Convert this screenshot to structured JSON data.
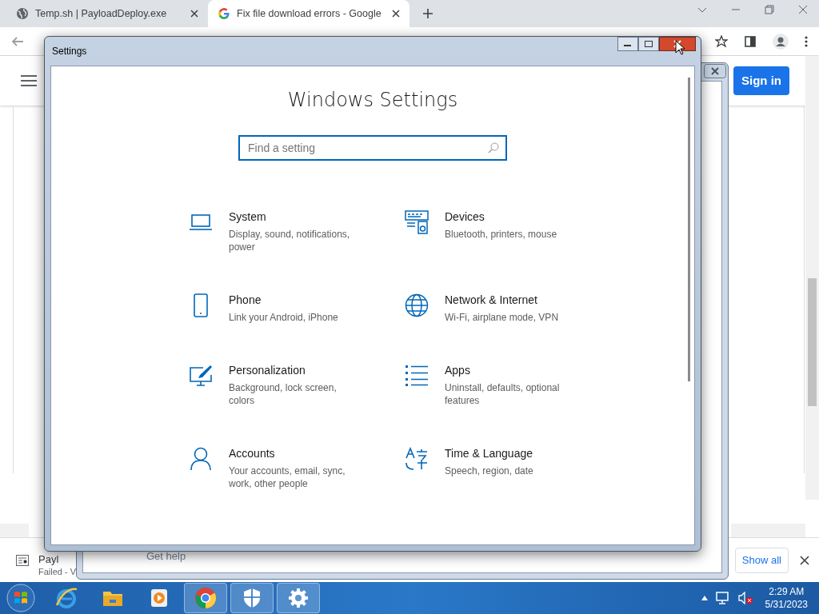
{
  "browser": {
    "tabs": [
      {
        "title": "Temp.sh | PayloadDeploy.exe",
        "kind": "globe",
        "selected": false
      },
      {
        "title": "Fix file download errors - Google",
        "kind": "google",
        "selected": true
      }
    ],
    "sign_in": "Sign in"
  },
  "download_bar": {
    "file_name": "Payl",
    "status": "Failed - V",
    "help": "Get help",
    "show_all": "Show all"
  },
  "settings_window": {
    "title": "Settings",
    "heading": "Windows Settings",
    "search": {
      "placeholder": "Find a setting"
    },
    "items": [
      {
        "kind": "system",
        "title": "System",
        "description": "Display, sound, notifications, power"
      },
      {
        "kind": "devices",
        "title": "Devices",
        "description": "Bluetooth, printers, mouse"
      },
      {
        "kind": "phone",
        "title": "Phone",
        "description": "Link your Android, iPhone"
      },
      {
        "kind": "network",
        "title": "Network & Internet",
        "description": "Wi-Fi, airplane mode, VPN"
      },
      {
        "kind": "personalization",
        "title": "Personalization",
        "description": "Background, lock screen, colors"
      },
      {
        "kind": "apps",
        "title": "Apps",
        "description": "Uninstall, defaults, optional features"
      },
      {
        "kind": "accounts",
        "title": "Accounts",
        "description": "Your accounts, email, sync, work, other people"
      },
      {
        "kind": "time",
        "title": "Time & Language",
        "description": "Speech, region, date"
      }
    ]
  },
  "taskbar": {
    "apps": [
      {
        "kind": "ie",
        "selected": false
      },
      {
        "kind": "explorer",
        "selected": false
      },
      {
        "kind": "media",
        "selected": false
      },
      {
        "kind": "chrome",
        "selected": true
      },
      {
        "kind": "shield",
        "selected": true
      },
      {
        "kind": "settings",
        "selected": true
      }
    ],
    "time": "2:29 AM",
    "date": "5/31/2023"
  }
}
